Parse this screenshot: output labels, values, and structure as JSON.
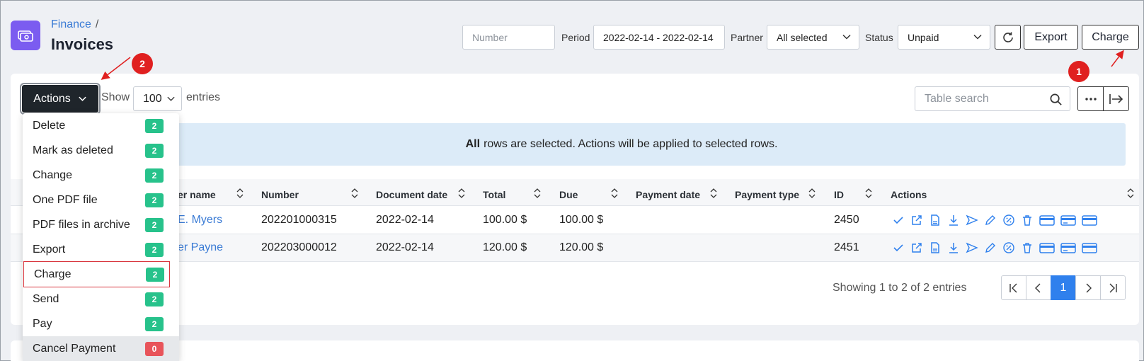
{
  "header": {
    "breadcrumb": "Finance",
    "breadcrumb_sep": "/",
    "title": "Invoices"
  },
  "filters": {
    "number_placeholder": "Number",
    "period_label": "Period",
    "period_value": "2022-02-14 - 2022-02-14",
    "partner_label": "Partner",
    "partner_value": "All selected",
    "status_label": "Status",
    "status_value": "Unpaid",
    "export_label": "Export",
    "charge_label": "Charge"
  },
  "toolbar": {
    "actions_label": "Actions",
    "show_label": "Show",
    "entries_value": "100",
    "entries_label": "entries",
    "search_placeholder": "Table search"
  },
  "banner": {
    "bold": "All",
    "text": "rows are selected. Actions will be applied to selected rows."
  },
  "table": {
    "columns": [
      "er name",
      "Number",
      "Document date",
      "Total",
      "Due",
      "Payment date",
      "Payment type",
      "ID",
      "Actions"
    ],
    "rows": [
      {
        "name": "E. Myers",
        "number": "202201000315",
        "date": "2022-02-14",
        "total": "100.00 $",
        "due": "100.00 $",
        "payment_date": "",
        "payment_type": "",
        "id": "2450"
      },
      {
        "name": "er Payne",
        "number": "202203000012",
        "date": "2022-02-14",
        "total": "120.00 $",
        "due": "120.00 $",
        "payment_date": "",
        "payment_type": "",
        "id": "2451"
      }
    ]
  },
  "pagination": {
    "showing": "Showing 1 to 2 of 2 entries",
    "current_page": "1"
  },
  "menu": {
    "items": [
      {
        "label": "Delete",
        "count": "2"
      },
      {
        "label": "Mark as deleted",
        "count": "2"
      },
      {
        "label": "Change",
        "count": "2"
      },
      {
        "label": "One PDF file",
        "count": "2"
      },
      {
        "label": "PDF files in archive",
        "count": "2"
      },
      {
        "label": "Export",
        "count": "2"
      },
      {
        "label": "Charge",
        "count": "2"
      },
      {
        "label": "Send",
        "count": "2"
      },
      {
        "label": "Pay",
        "count": "2"
      },
      {
        "label": "Cancel Payment",
        "count": "0"
      }
    ]
  },
  "annotations": {
    "step1": "1",
    "step2": "2"
  },
  "colors": {
    "accent": "#2f80ed",
    "brand_icon": "#7b5cf0",
    "badge_green": "#27c28b",
    "badge_red": "#e8545a",
    "annotation_red": "#e02020",
    "link": "#3a7bd5"
  }
}
